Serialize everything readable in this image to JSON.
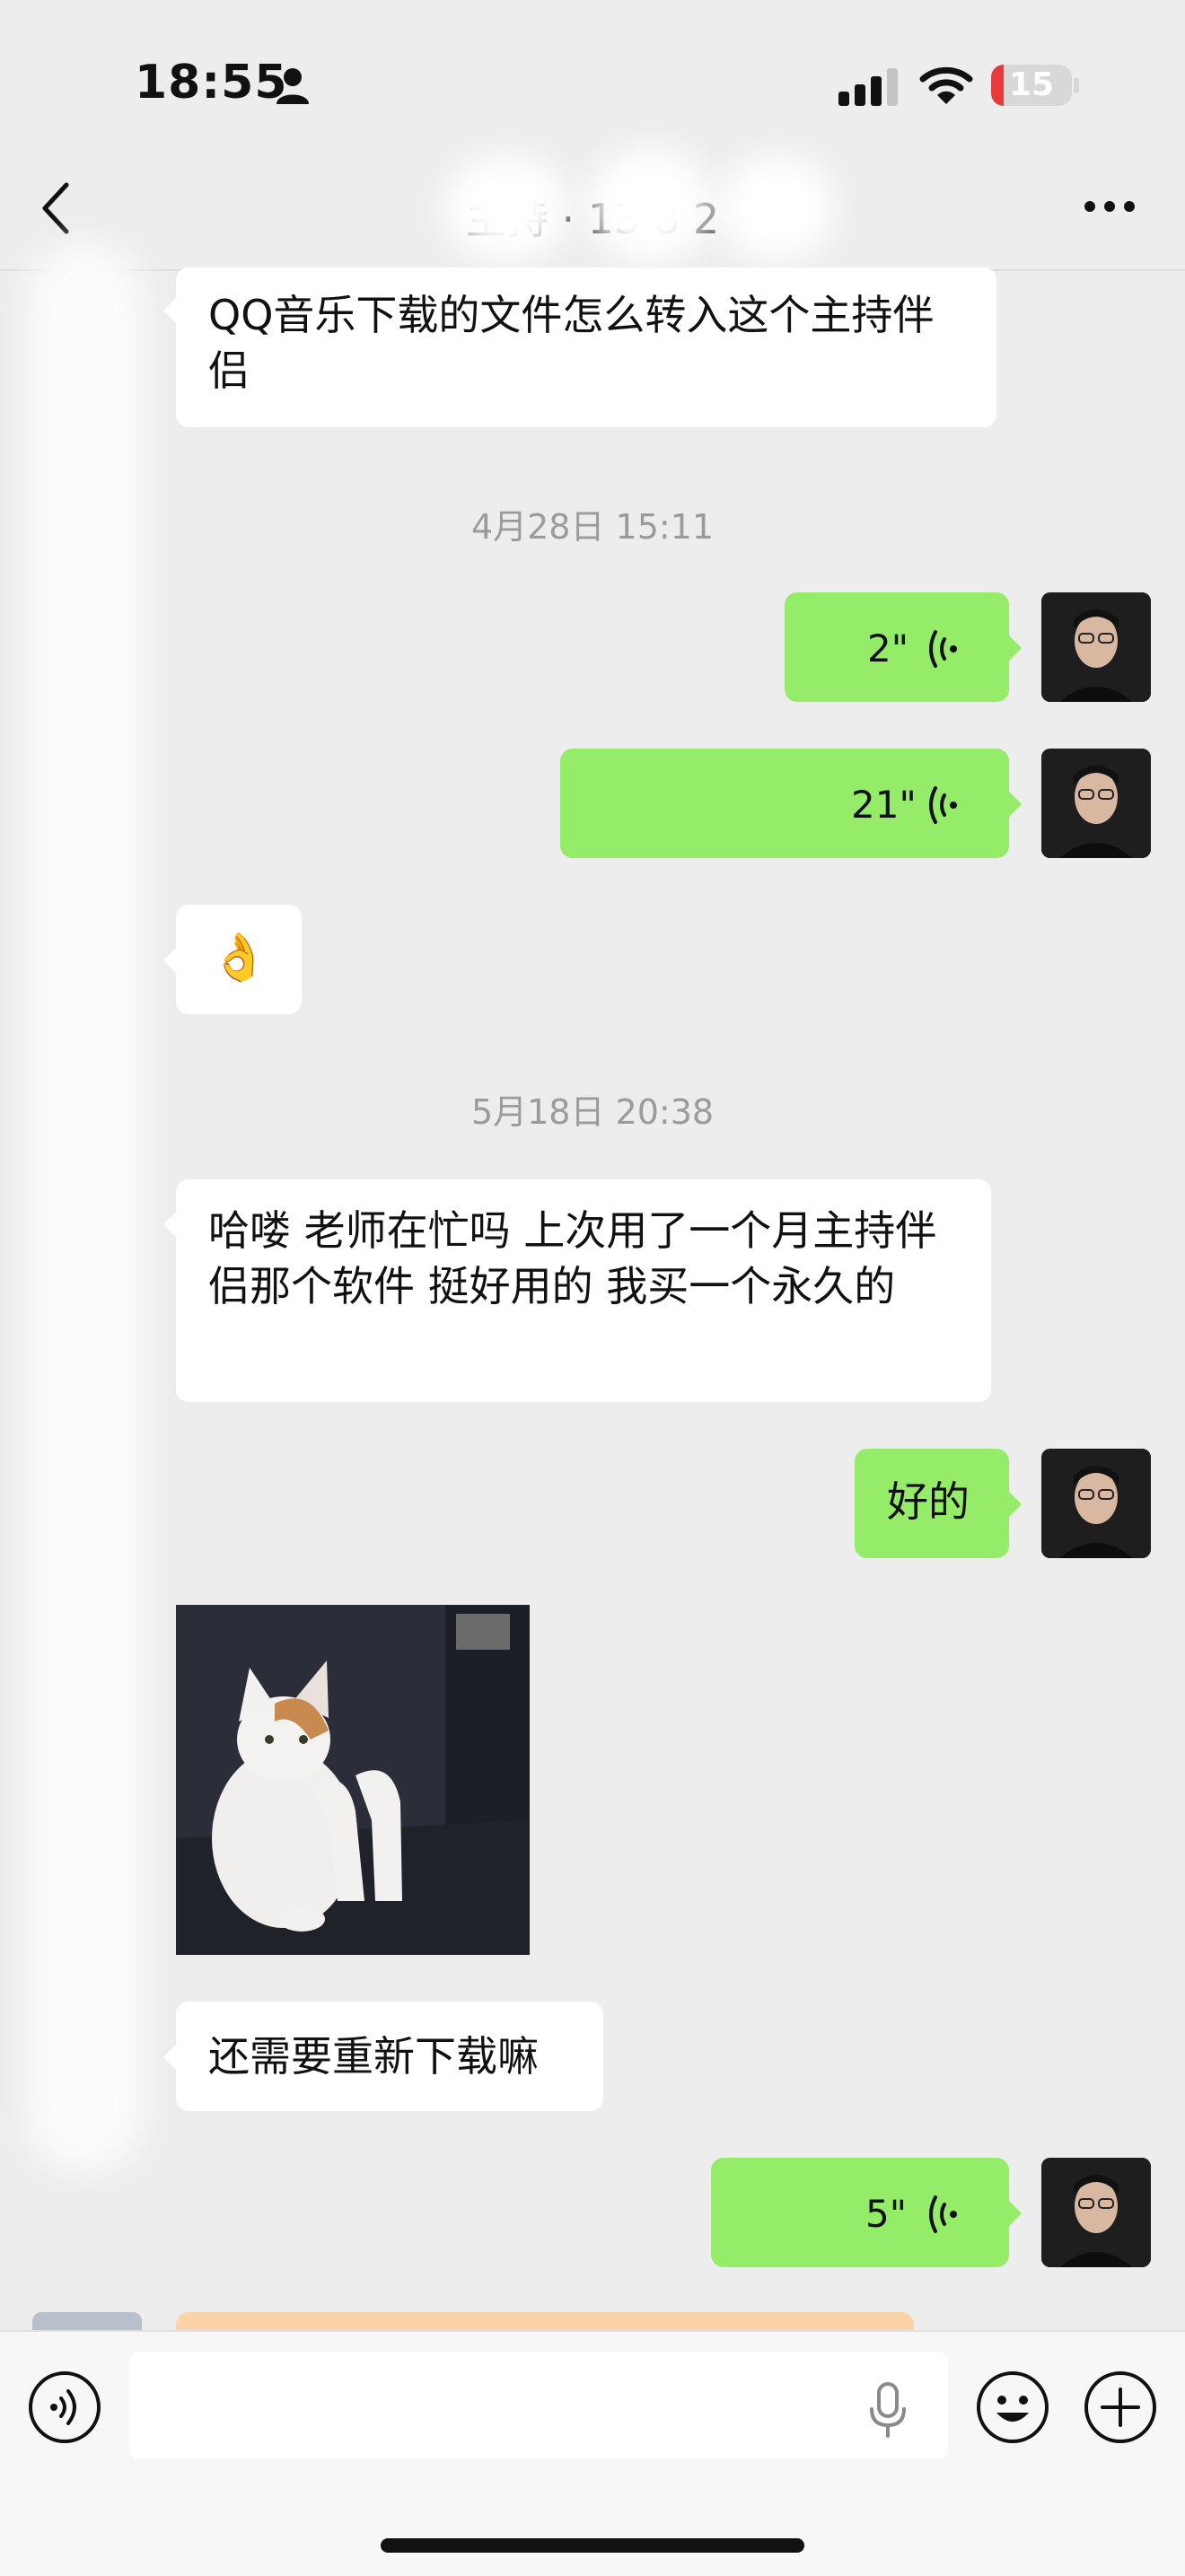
{
  "status_bar": {
    "time": "18:55",
    "battery": "15",
    "battery_level_pct": 15
  },
  "nav": {
    "back_icon": "chevron-left-icon",
    "title": "主持 · 13 8 2",
    "more_icon": "more-horizontal-icon"
  },
  "messages": {
    "m1_text": "QQ音乐下载的文件怎么转入这个主持伴侣",
    "ts1": "4月28日 15:11",
    "v1": "2\"",
    "v2": "21\"",
    "m2_emoji": "👌",
    "ts2": "5月18日 20:38",
    "m3_text": "哈喽 老师在忙吗 上次用了一个月主持伴侣那个软件 挺好用的 我买一个永久的",
    "m4_text": "好的",
    "m5_image": "cat-image",
    "m6_text": "还需要重新下载嘛",
    "v3": "5\""
  },
  "input_bar": {
    "voice_icon": "voice-mode-icon",
    "mic_icon": "microphone-icon",
    "emoji_icon": "emoji-icon",
    "plus_icon": "plus-icon"
  },
  "colors": {
    "outgoing_bubble": "#95ec69",
    "incoming_bubble": "#ffffff",
    "background": "#ededed"
  }
}
